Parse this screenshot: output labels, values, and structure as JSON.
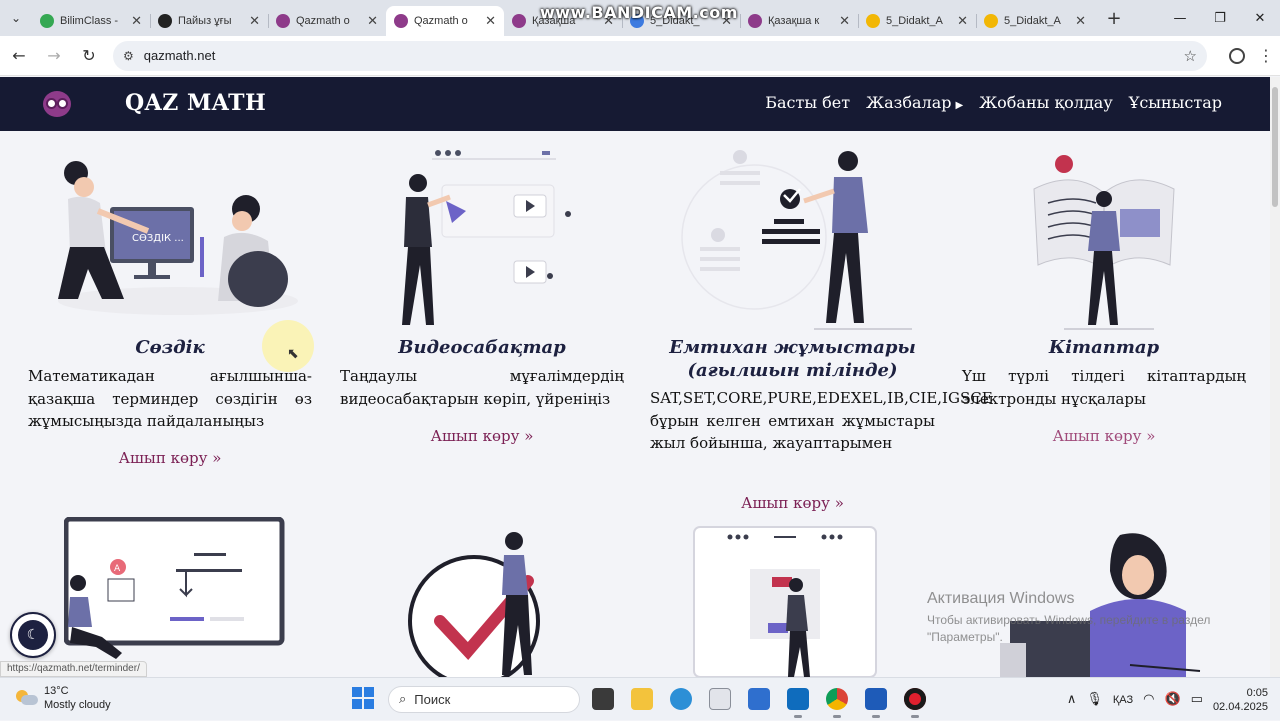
{
  "browser": {
    "tabs": [
      {
        "title": "BilimClass -",
        "color": "#35a853",
        "active": false
      },
      {
        "title": "Пайыз ұғы",
        "color": "#222222",
        "active": false
      },
      {
        "title": "Qazmath о",
        "color": "#8e3b8a",
        "active": false
      },
      {
        "title": "Qazmath о",
        "color": "#8e3b8a",
        "active": true
      },
      {
        "title": "Қазақша",
        "color": "#8e3b8a",
        "active": false
      },
      {
        "title": "5_Didakt_",
        "color": "#3d7be0",
        "active": false
      },
      {
        "title": "Қазақша к",
        "color": "#8e3b8a",
        "active": false
      },
      {
        "title": "5_Didakt_A",
        "color": "#f2b705",
        "active": false
      },
      {
        "title": "5_Didakt_A",
        "color": "#f2b705",
        "active": false
      }
    ],
    "url": "qazmath.net",
    "recording_watermark": "www.BANDICAM.com"
  },
  "site": {
    "brand": "QAZ MATH",
    "nav": [
      {
        "label": "Басты бет",
        "caret": false
      },
      {
        "label": "Жазбалар",
        "caret": true
      },
      {
        "label": "Жобаны қолдау",
        "caret": false
      },
      {
        "label": "Ұсыныстар",
        "caret": false
      }
    ],
    "cards": [
      {
        "title": "Сөздік",
        "text": "Математикадан ағылшынша-қазақша терминдер сөздігін өз жұмысыңызда пайдаланыңыз",
        "link": "Ашып көру »"
      },
      {
        "title": "Видеосабақтар",
        "text": "Таңдаулы мұғалімдердің видеосабақтарын көріп, үйреніңіз",
        "link": "Ашып көру »"
      },
      {
        "title": "Емтихан жұмыстары (ағылшын тілінде)",
        "text": "SAT,SET,CORE,PURE,EDEXEL,IB,CIE,IGSCE бұрын келген емтихан жұмыстары жыл бойынша, жауаптарымен",
        "link": "Ашып көру »"
      },
      {
        "title": "Кітаптар",
        "text": "Үш түрлі тілдегі кітаптардың электронды нұсқалары",
        "link": "Ашып көру »"
      }
    ],
    "illustration_labels": {
      "dictionary_screen": "СӨЗДІК ..."
    },
    "status_url": "https://qazmath.net/terminder/",
    "accent_color": "#161a33",
    "link_color": "#7b2054",
    "illustration_purple": "#6c63c7"
  },
  "windows_activation": {
    "line1": "Активация Windows",
    "line2": "Чтобы активировать Windows, перейдите в раздел \"Параметры\"."
  },
  "taskbar": {
    "weather_temp": "13°C",
    "weather_desc": "Mostly cloudy",
    "search_placeholder": "Поиск",
    "language": "ҚАЗ",
    "time": "0:05",
    "date": "02.04.2025"
  }
}
